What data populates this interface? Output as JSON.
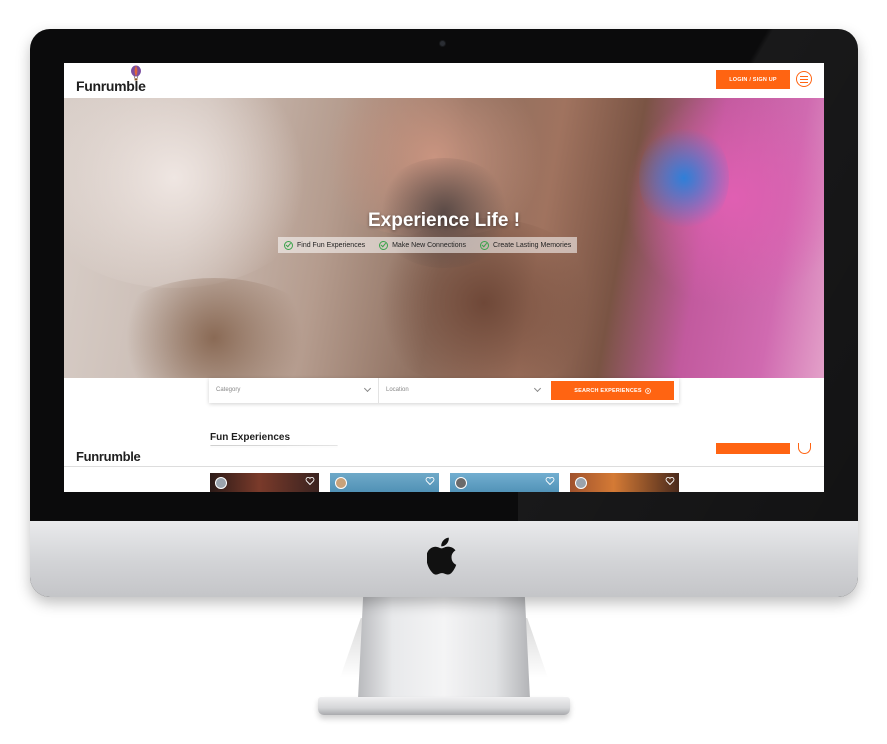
{
  "site": {
    "logo_text": "Funrumble",
    "login_label": "LOGIN / SIGN UP",
    "menu_icon": "menu-icon"
  },
  "hero": {
    "title": "Experience Life !",
    "features": [
      {
        "icon": "check-circle-icon",
        "label": "Find Fun Experiences"
      },
      {
        "icon": "check-circle-icon",
        "label": "Make New Connections"
      },
      {
        "icon": "check-circle-icon",
        "label": "Create Lasting Memories"
      }
    ]
  },
  "search": {
    "category_placeholder": "Category",
    "location_placeholder": "Location",
    "button_label": "SEARCH EXPERIENCES"
  },
  "section": {
    "title": "Fun Experiences"
  },
  "sticky_header": {
    "logo_text": "Funrumble"
  },
  "cards": [
    {
      "avatar": "user-avatar-icon",
      "heart": "heart-icon"
    },
    {
      "avatar": "user-avatar-icon",
      "heart": "heart-icon"
    },
    {
      "avatar": "user-avatar-icon",
      "heart": "heart-icon"
    },
    {
      "avatar": "user-avatar-icon",
      "heart": "heart-icon"
    }
  ],
  "colors": {
    "accent": "#ff6412",
    "check": "#3aa34b",
    "monitor_bezel": "#0b0b0c"
  }
}
